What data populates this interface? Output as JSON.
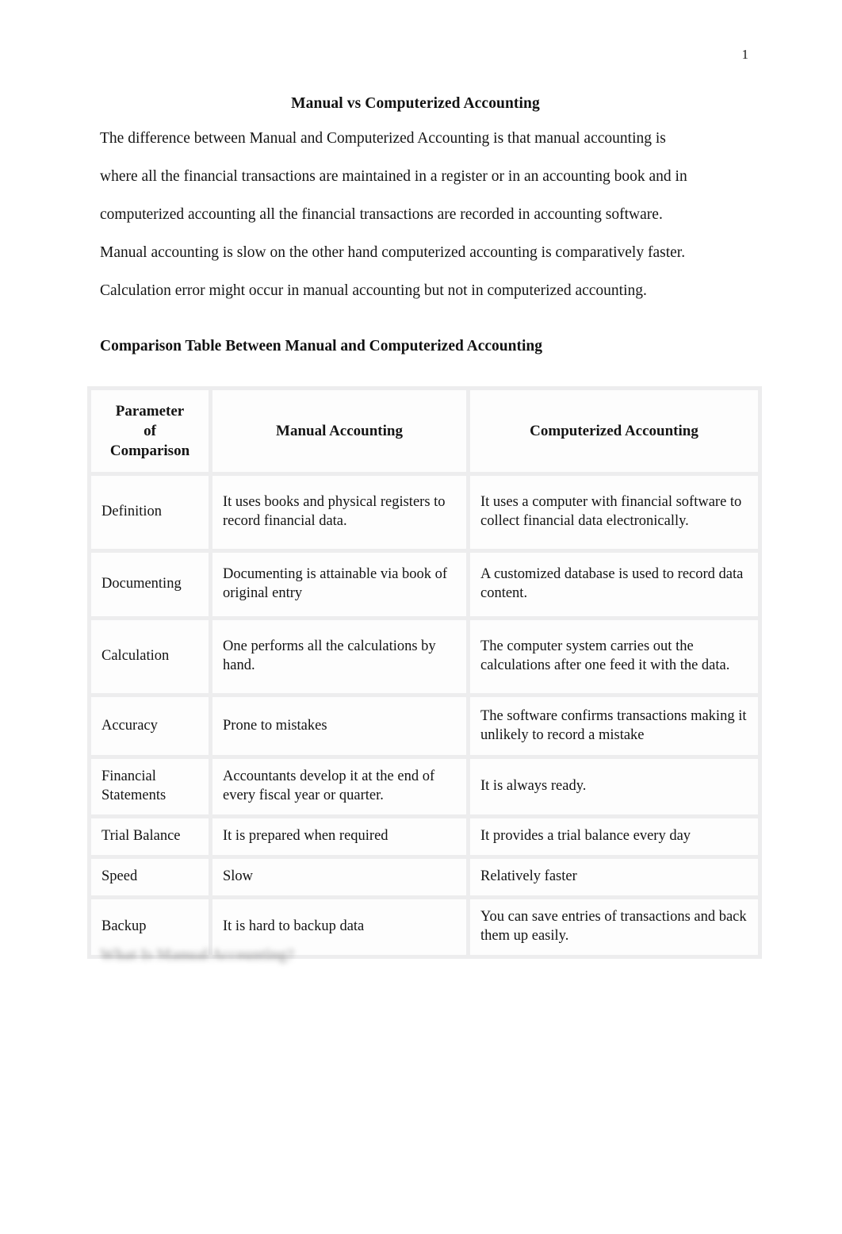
{
  "document": {
    "page_number": "1",
    "title": "Manual vs Computerized Accounting",
    "paragraphs": [
      "The difference between Manual and Computerized Accounting is that manual accounting is",
      "where all the financial transactions are maintained in a register or in an accounting book and in",
      "computerized accounting all the financial transactions are recorded in accounting software.",
      "Manual accounting is slow on the other hand computerized accounting is comparatively faster.",
      "Calculation error might occur in manual accounting but not in computerized accounting."
    ],
    "section_heading": "Comparison Table Between Manual and Computerized Accounting",
    "trailing_heading": "What Is Manual Accounting?"
  },
  "table": {
    "headers": {
      "parameter": "Parameter of Comparison",
      "parameter_line1": "Parameter",
      "parameter_line2": "of",
      "parameter_line3": "Comparison",
      "manual": "Manual Accounting",
      "computerized": "Computerized Accounting"
    },
    "rows": [
      {
        "parameter": "Definition",
        "manual": "It uses books and physical registers to record financial data.",
        "computerized": "It uses a computer with financial software to collect financial data electronically."
      },
      {
        "parameter": "Documenting",
        "manual": "Documenting is attainable via book of original entry",
        "computerized": "A customized database is used to record data content."
      },
      {
        "parameter": "Calculation",
        "manual": "One performs all the calculations by hand.",
        "computerized": "The computer system carries out the calculations after one feed it with the data."
      },
      {
        "parameter": "Accuracy",
        "manual": "Prone to mistakes",
        "computerized": "The software confirms transactions making it unlikely to record a mistake"
      },
      {
        "parameter": "Financial Statements",
        "manual": "Accountants develop it at the end of every fiscal year or quarter.",
        "computerized": "It is always ready."
      },
      {
        "parameter": "Trial Balance",
        "manual": "It is prepared when required",
        "computerized": "It provides a trial balance every day"
      },
      {
        "parameter": "Speed",
        "manual": "Slow",
        "computerized": "Relatively faster"
      },
      {
        "parameter": "Backup",
        "manual": "It is hard to backup data",
        "computerized": "You can save entries of transactions and back them up easily."
      }
    ]
  },
  "colors": {
    "page_background": "#ffffff",
    "cell_background": "#fdfdfd",
    "grid_gutter": "#ededee",
    "text": "#141414"
  }
}
